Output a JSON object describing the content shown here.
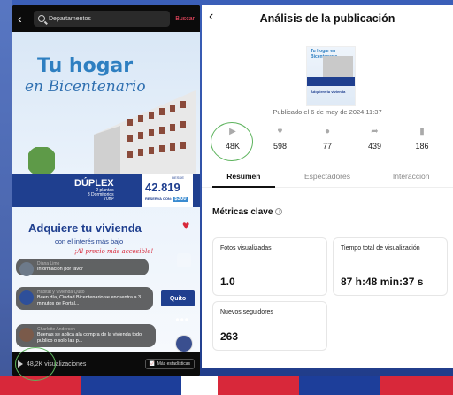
{
  "left_phone": {
    "search_placeholder": "Departamentos",
    "search_button": "Buscar",
    "ad": {
      "title_1": "Tu hogar",
      "title_2": "en Bicentenario",
      "duplex": "DÚPLEX",
      "duplex_sub_1": "2 plantas",
      "duplex_sub_2": "3 Dormitorios",
      "duplex_area": "70m²",
      "desde": "DESDE",
      "price": "42.819",
      "reserva_label": "RESERVA CON:",
      "reserva_amount": "$300",
      "headline": "Adquiere tu vivienda",
      "interest": "con el interés más bajo",
      "accesible": "¡Al precio más accesible!"
    },
    "comments": [
      {
        "name": "Diana Limo",
        "text": "Información por favor"
      },
      {
        "name": "Hábitat y Vivienda Quito",
        "text": "Buen día, Ciudad Bicentenario se encuentra a 3 minutos de Portal..."
      },
      {
        "name": "Charlotte Anderson",
        "text": "Buenas se aplica ala compra de la vivienda todo publico o solo las p..."
      }
    ],
    "quito_logo": "Quito",
    "views": "48,2K visualizaciones",
    "stats_button": "Más estadísticas"
  },
  "right_panel": {
    "title": "Análisis de la publicación",
    "thumb_title": "Tu hogar en Bicentenario",
    "thumb_sub": "Adquiere tu vivienda",
    "published": "Publicado el 6 de may de 2024 11:37",
    "stats": [
      {
        "icon": "play-icon",
        "value": "48K"
      },
      {
        "icon": "heart-icon",
        "value": "598"
      },
      {
        "icon": "comment-icon",
        "value": "77"
      },
      {
        "icon": "share-icon",
        "value": "439"
      },
      {
        "icon": "bookmark-icon",
        "value": "186"
      }
    ],
    "tabs": [
      "Resumen",
      "Espectadores",
      "Interacción"
    ],
    "metrics_title": "Métricas clave",
    "metrics": [
      {
        "label": "Fotos visualizadas",
        "value": "1.0"
      },
      {
        "label": "Tiempo total de visualización",
        "value": "87 h:48 min:37 s"
      },
      {
        "label": "Nuevos seguidores",
        "value": "263"
      }
    ]
  },
  "colors": {
    "brand_blue": "#1f3f8f",
    "highlight_green": "#5db35d",
    "accent_red": "#d8283a"
  }
}
